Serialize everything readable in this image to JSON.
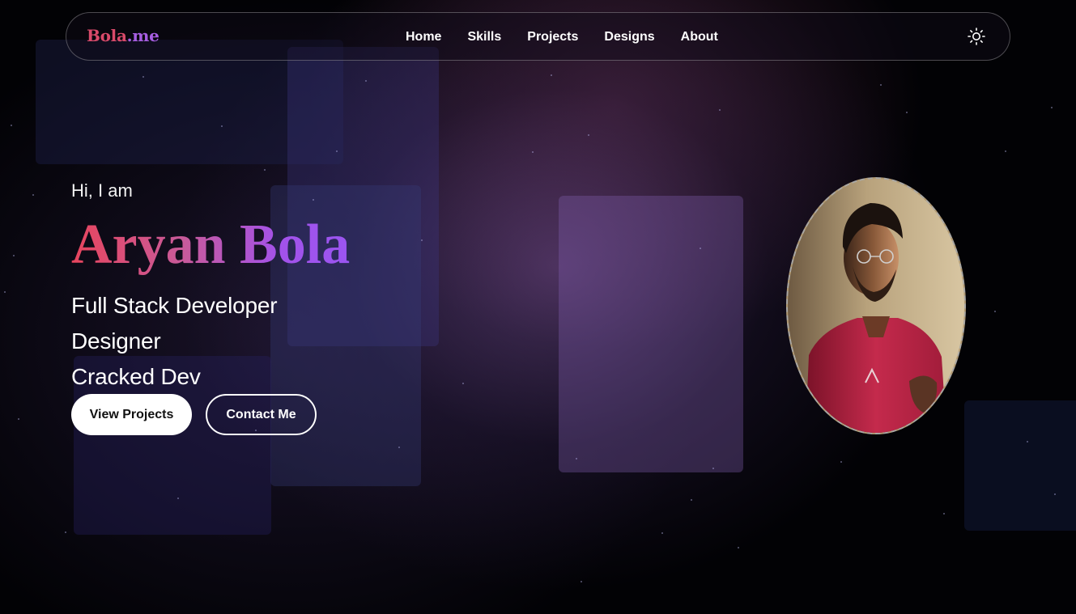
{
  "brand": {
    "name": "Bola",
    "tld": ".me",
    "primary_color": "#d94a6a",
    "accent_color": "#a65de0"
  },
  "nav": {
    "links": [
      "Home",
      "Skills",
      "Projects",
      "Designs",
      "About"
    ],
    "theme_toggle_icon": "sun-icon"
  },
  "hero": {
    "greeting": "Hi, I am",
    "name": "Aryan Bola",
    "roles": [
      "Full Stack Developer",
      "Designer",
      "Cracked Dev"
    ],
    "primary_button": "View Projects",
    "secondary_button": "Contact Me",
    "name_gradient": [
      "#e8455d",
      "#9a55f0"
    ]
  },
  "portrait": {
    "icon": "profile-photo"
  },
  "colors": {
    "background": "#020205",
    "glow": "#785096",
    "text": "#ffffff"
  }
}
